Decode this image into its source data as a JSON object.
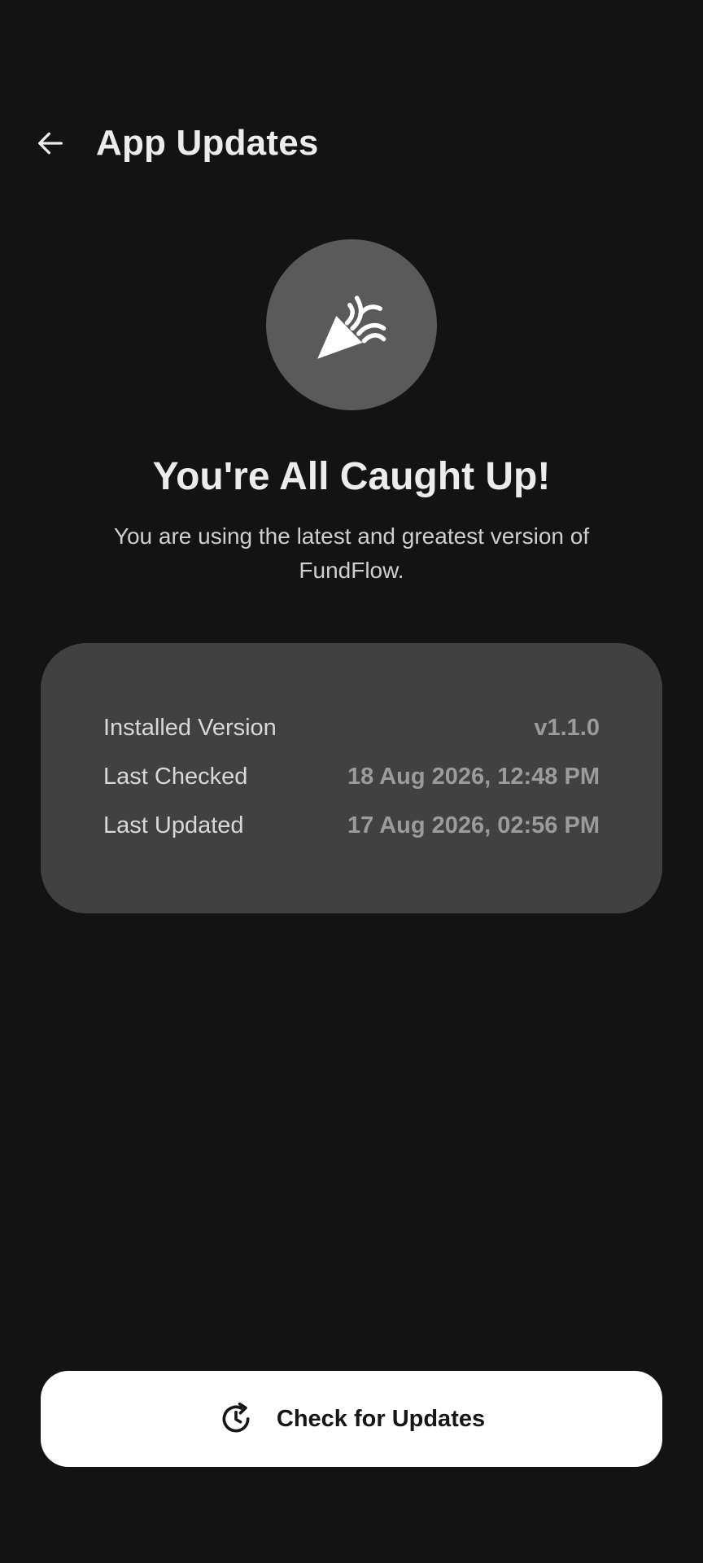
{
  "header": {
    "title": "App Updates",
    "back_icon": "arrow-left-icon"
  },
  "hero": {
    "icon": "party-popper-icon",
    "circle_color": "#5a5a5a",
    "headline": "You're All Caught Up!",
    "subtext": "You are using the latest and greatest version of FundFlow."
  },
  "info": {
    "rows": [
      {
        "label": "Installed Version",
        "value": "v1.1.0"
      },
      {
        "label": "Last Checked",
        "value": "18 Aug 2026, 12:48 PM"
      },
      {
        "label": "Last Updated",
        "value": "17 Aug 2026, 02:56 PM"
      }
    ]
  },
  "action": {
    "label": "Check for Updates",
    "icon": "clock-refresh-icon"
  },
  "colors": {
    "background": "#131313",
    "card": "#414141",
    "button": "#ffffff"
  }
}
